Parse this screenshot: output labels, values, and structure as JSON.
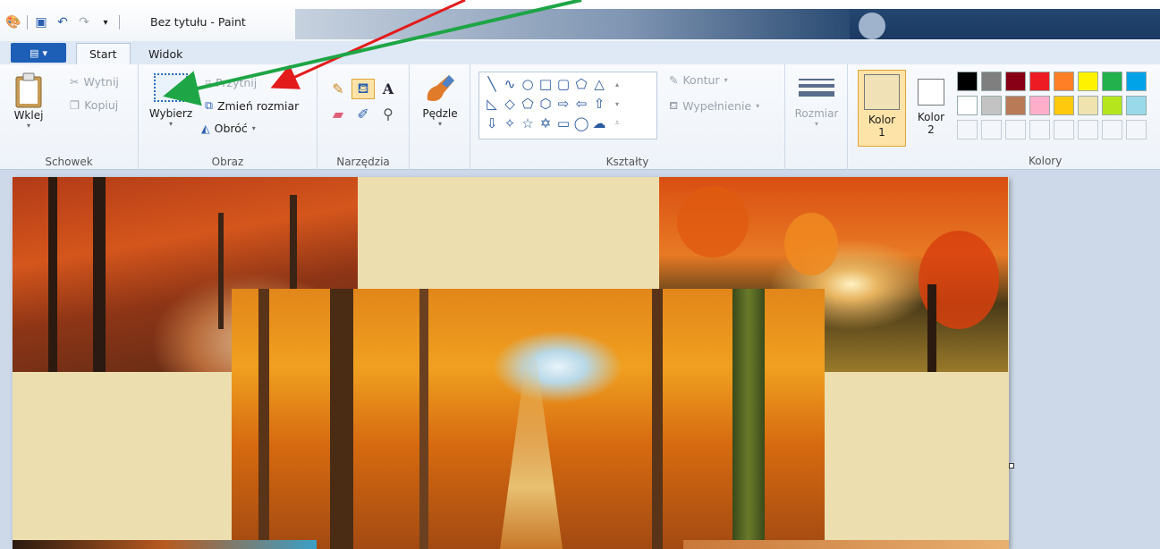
{
  "window": {
    "title": "Bez tytułu - Paint"
  },
  "tabs": {
    "start": "Start",
    "view": "Widok"
  },
  "ribbon": {
    "clipboard": {
      "label": "Schowek",
      "paste": "Wklej",
      "cut": "Wytnij",
      "copy": "Kopiuj"
    },
    "image": {
      "label": "Obraz",
      "select": "Wybierz",
      "crop": "Przytnij",
      "resize": "Zmień rozmiar",
      "rotate": "Obróć"
    },
    "tools": {
      "label": "Narzędzia"
    },
    "brushes": {
      "label": "Pędzle"
    },
    "shapes": {
      "label": "Kształty",
      "outline": "Kontur",
      "fill": "Wypełnienie"
    },
    "size": {
      "label": "Rozmiar"
    },
    "color1": {
      "label": "Kolor",
      "num": "1",
      "value": "#f0e2b6"
    },
    "color2": {
      "label": "Kolor",
      "num": "2",
      "value": "#ffffff"
    },
    "colors": {
      "label": "Kolory"
    }
  },
  "palette": {
    "row1": [
      "#000000",
      "#7f7f7f",
      "#880015",
      "#ed1c24",
      "#ff7f27",
      "#fff200",
      "#22b14c",
      "#00a2e8"
    ],
    "row2": [
      "#ffffff",
      "#c3c3c3",
      "#b97a57",
      "#ffaec9",
      "#ffc90e",
      "#efe4b0",
      "#b5e61d",
      "#99d9ea"
    ]
  },
  "canvas": {
    "background": "#ecdeae"
  }
}
